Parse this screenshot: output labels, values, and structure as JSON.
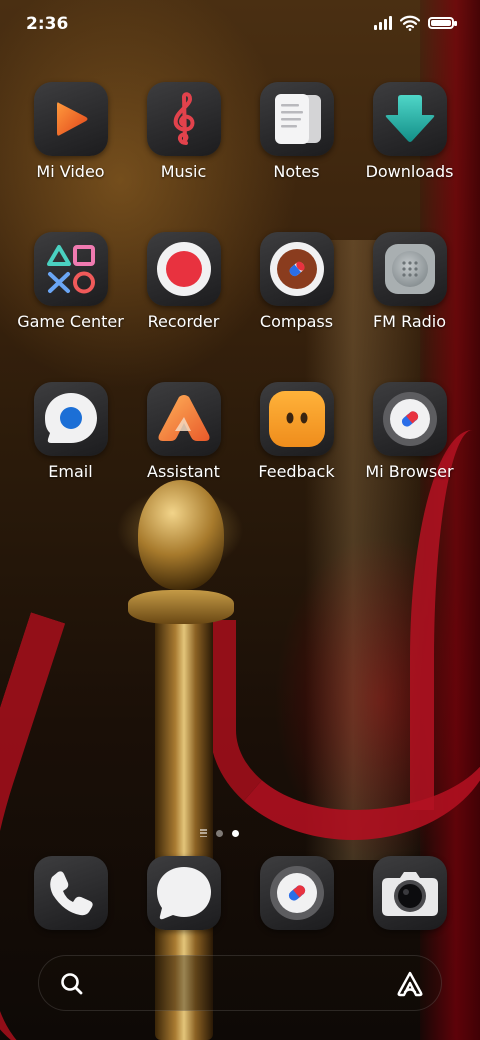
{
  "status_bar": {
    "time": "2:36",
    "icons": [
      "signal-icon",
      "wifi-icon",
      "battery-icon"
    ],
    "battery_level": 1.0
  },
  "apps": [
    {
      "label": "Mi Video",
      "icon": "play-icon",
      "accent": "#f06a22"
    },
    {
      "label": "Music",
      "icon": "treble-clef-icon",
      "accent": "#e2424c"
    },
    {
      "label": "Notes",
      "icon": "notes-icon",
      "accent": "#e9e9ea"
    },
    {
      "label": "Downloads",
      "icon": "download-arrow-icon",
      "accent": "#21b0a8"
    },
    {
      "label": "Game Center",
      "icon": "game-shapes-icon",
      "accent": "#4ad0c0"
    },
    {
      "label": "Recorder",
      "icon": "record-icon",
      "accent": "#e8323f"
    },
    {
      "label": "Compass",
      "icon": "compass-icon",
      "accent": "#8a3c1e"
    },
    {
      "label": "FM Radio",
      "icon": "radio-speaker-icon",
      "accent": "#9aa2a4"
    },
    {
      "label": "Email",
      "icon": "email-bubble-icon",
      "accent": "#1c6fd6"
    },
    {
      "label": "Assistant",
      "icon": "assistant-a-icon",
      "accent": "#f08a3a"
    },
    {
      "label": "Feedback",
      "icon": "feedback-face-icon",
      "accent": "#f29a24"
    },
    {
      "label": "Mi Browser",
      "icon": "browser-compass-icon",
      "accent": "#2b6ee8"
    }
  ],
  "page_indicator": {
    "pages": 2,
    "active_page": 2
  },
  "dock": [
    {
      "name": "phone",
      "icon": "phone-icon"
    },
    {
      "name": "messages",
      "icon": "message-bubble-icon"
    },
    {
      "name": "browser",
      "icon": "browser-compass-icon"
    },
    {
      "name": "camera",
      "icon": "camera-icon"
    }
  ],
  "search": {
    "icons": [
      "search-icon",
      "assistant-icon"
    ]
  }
}
